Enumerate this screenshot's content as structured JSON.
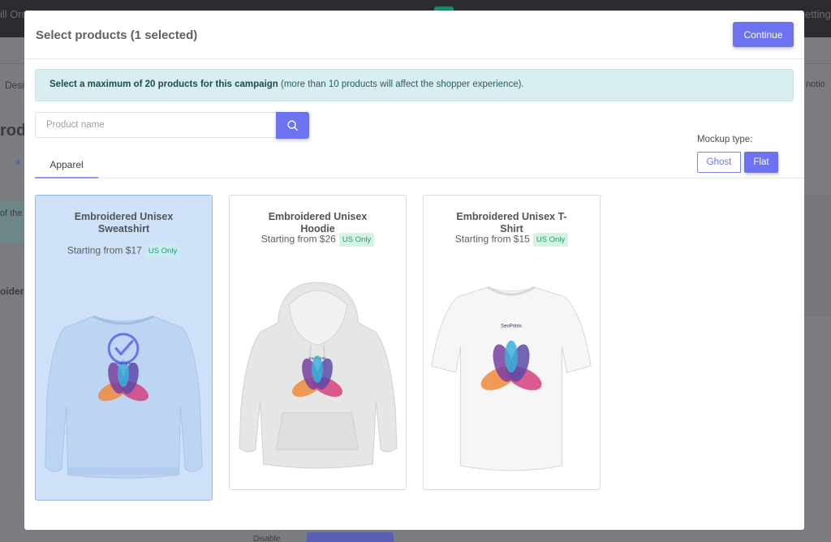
{
  "background": {
    "topbar_fragments": [
      "ill Ord",
      "etting"
    ],
    "side_fragments": [
      "Desi",
      "rodu",
      "+",
      "of the",
      "oidere",
      "notio"
    ],
    "bottom_fragment": "Disable"
  },
  "modal": {
    "title": "Select products (1 selected)",
    "continue_label": "Continue",
    "alert": {
      "bold": "Select a maximum of 20 products for this campaign",
      "rest": " (more than 10 products will affect the shopper experience)."
    },
    "search": {
      "placeholder": "Product name",
      "value": "",
      "button_icon": "search-icon"
    },
    "mockup": {
      "label": "Mockup type:",
      "options": [
        "Ghost",
        "Flat"
      ],
      "selected": "Flat"
    },
    "tabs": [
      {
        "label": "Apparel",
        "active": true
      }
    ],
    "products": [
      {
        "title": "Embroidered Unisex Sweatshirt",
        "price": "Starting from $17",
        "badge": "US Only",
        "selected": true,
        "garment_color": "#bcd5f3",
        "selected_icon": "check-circle-icon"
      },
      {
        "title": "Embroidered Unisex Hoodie",
        "price": "Starting from $26",
        "badge": "US Only",
        "selected": false,
        "garment_color": "#e7e7e7"
      },
      {
        "title": "Embroidered Unisex T-Shirt",
        "price": "Starting from $15",
        "badge": "US Only",
        "selected": false,
        "garment_color": "#f4f4f4"
      }
    ],
    "brand_print": "SenPrints",
    "colors": {
      "accent": "#6c72f0",
      "alert_bg": "#d8eef1",
      "selected_card_bg": "#cfe1f9",
      "badge_bg": "#d4f4e3",
      "badge_text": "#1e9e63"
    }
  }
}
